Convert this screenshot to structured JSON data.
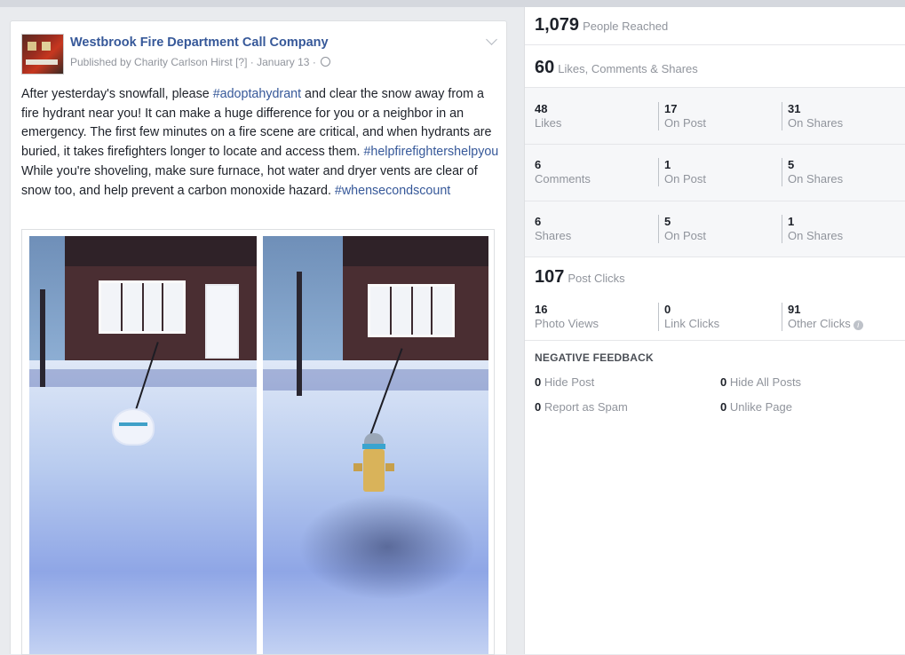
{
  "post": {
    "page_name": "Westbrook Fire Department Call Company",
    "published_prefix": "Published by ",
    "publisher": "Charity Carlson Hirst",
    "publisher_flag": "[?]",
    "date_sep": " · ",
    "date": "January 13",
    "date_tail": " · ",
    "text_parts": [
      "After yesterday's snowfall, please ",
      "#adoptahydrant",
      " and clear the snow away from a fire hydrant near you! It can make a huge difference for you or a neighbor in an emergency. The first few minutes on a fire scene are critical, and when hydrants are buried, it takes firefighters longer to locate and access them. ",
      "#helpfirefightershelpyou",
      " While you're shoveling, make sure furnace, hot water and dryer vents are clear of snow too, and help prevent a carbon monoxide hazard. ",
      "#whensecondscount"
    ]
  },
  "stats": {
    "reached": {
      "value": "1,079",
      "label": "People Reached"
    },
    "engagement": {
      "value": "60",
      "label": "Likes, Comments & Shares"
    },
    "rows": [
      {
        "total": "48",
        "total_label": "Likes",
        "on_post": "17",
        "on_post_label": "On Post",
        "on_shares": "31",
        "on_shares_label": "On Shares"
      },
      {
        "total": "6",
        "total_label": "Comments",
        "on_post": "1",
        "on_post_label": "On Post",
        "on_shares": "5",
        "on_shares_label": "On Shares"
      },
      {
        "total": "6",
        "total_label": "Shares",
        "on_post": "5",
        "on_post_label": "On Post",
        "on_shares": "1",
        "on_shares_label": "On Shares"
      }
    ],
    "clicks": {
      "value": "107",
      "label": "Post Clicks"
    },
    "click_breakdown": [
      {
        "value": "16",
        "label": "Photo Views"
      },
      {
        "value": "0",
        "label": "Link Clicks"
      },
      {
        "value": "91",
        "label": "Other Clicks"
      }
    ],
    "negative": {
      "heading": "NEGATIVE FEEDBACK",
      "items": [
        {
          "value": "0",
          "label": "Hide Post"
        },
        {
          "value": "0",
          "label": "Hide All Posts"
        },
        {
          "value": "0",
          "label": "Report as Spam"
        },
        {
          "value": "0",
          "label": "Unlike Page"
        }
      ]
    },
    "info_glyph": "i"
  },
  "icons": {
    "globe": "globe-icon",
    "chevron": "chevron-down-icon",
    "info": "info-icon"
  },
  "colors": {
    "link": "#365899",
    "muted": "#90949c",
    "text": "#1d2129",
    "background": "#e9ebee"
  }
}
